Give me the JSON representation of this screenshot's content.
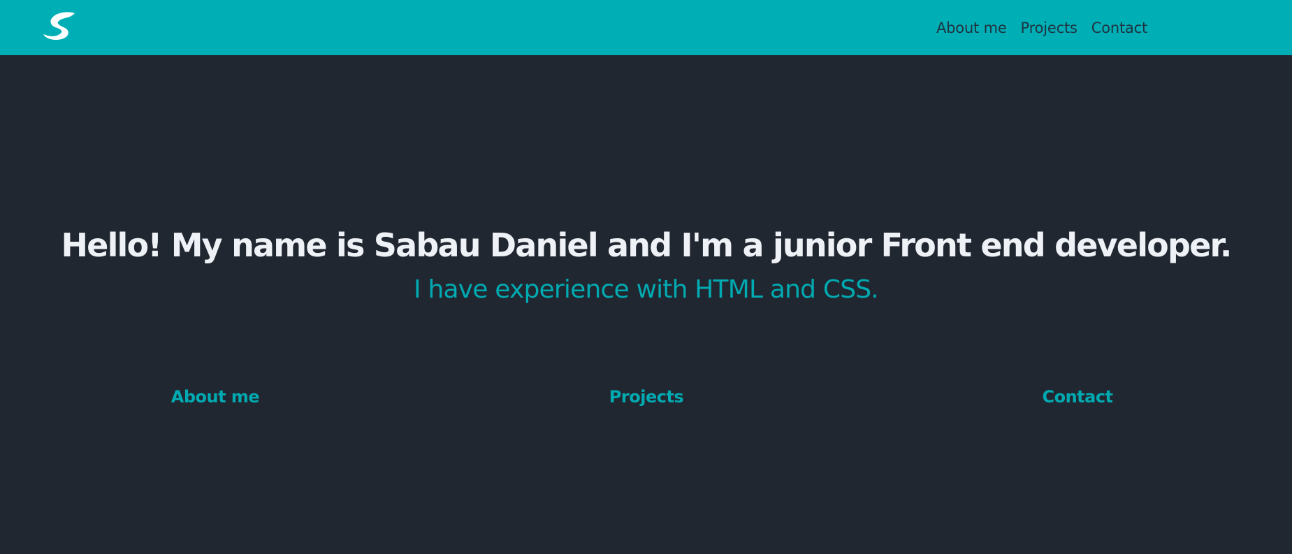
{
  "navbar": {
    "logo_icon": "s-logo-icon",
    "links": [
      {
        "label": "About me"
      },
      {
        "label": "Projects"
      },
      {
        "label": "Contact"
      }
    ]
  },
  "hero": {
    "title": "Hello! My name is Sabau Daniel and I'm a junior Front end developer.",
    "subtitle": "I have experience with HTML and CSS."
  },
  "sections": [
    {
      "label": "About me"
    },
    {
      "label": "Projects"
    },
    {
      "label": "Contact"
    }
  ],
  "colors": {
    "navbar_bg": "#00aeb5",
    "page_bg": "#212731",
    "accent": "#00aab1",
    "title_text": "#eef1f5",
    "nav_text": "#1f3442"
  }
}
